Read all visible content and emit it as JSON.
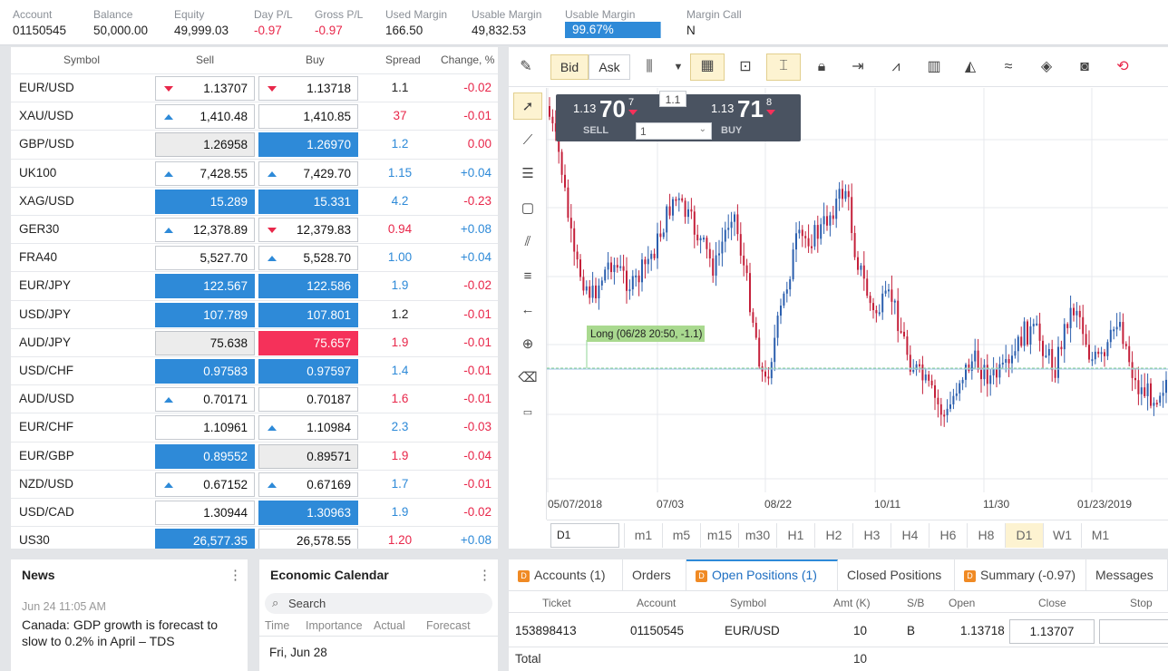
{
  "header": [
    {
      "label": "Account",
      "value": "01150545",
      "style": ""
    },
    {
      "label": "Balance",
      "value": "50,000.00",
      "style": ""
    },
    {
      "label": "Equity",
      "value": "49,999.03",
      "style": ""
    },
    {
      "label": "Day P/L",
      "value": "-0.97",
      "style": "neg"
    },
    {
      "label": "Gross P/L",
      "value": "-0.97",
      "style": "neg"
    },
    {
      "label": "Used Margin",
      "value": "166.50",
      "style": ""
    },
    {
      "label": "Usable Margin",
      "value": "49,832.53",
      "style": ""
    },
    {
      "label": "Usable Margin",
      "value": "99.67%",
      "style": "bar",
      "fill": 0.9967
    },
    {
      "label": "Margin Call",
      "value": "N",
      "style": ""
    }
  ],
  "watchlist": {
    "columns": [
      "Symbol",
      "Sell",
      "Buy",
      "Spread",
      "Change, %"
    ],
    "rows": [
      {
        "symbol": "EUR/USD",
        "sell": "1.13707",
        "sell_style": "white",
        "sell_arrow": "down",
        "buy": "1.13718",
        "buy_style": "white",
        "buy_arrow": "down",
        "spread": "1.1",
        "spread_color": "dark",
        "change": "-0.02",
        "change_color": "red"
      },
      {
        "symbol": "XAU/USD",
        "sell": "1,410.48",
        "sell_style": "white",
        "sell_arrow": "up",
        "buy": "1,410.85",
        "buy_style": "white",
        "buy_arrow": "",
        "spread": "37",
        "spread_color": "red",
        "change": "-0.01",
        "change_color": "red"
      },
      {
        "symbol": "GBP/USD",
        "sell": "1.26958",
        "sell_style": "gray",
        "sell_arrow": "",
        "buy": "1.26970",
        "buy_style": "blue",
        "buy_arrow": "",
        "spread": "1.2",
        "spread_color": "blue",
        "change": "0.00",
        "change_color": "red"
      },
      {
        "symbol": "UK100",
        "sell": "7,428.55",
        "sell_style": "white",
        "sell_arrow": "up",
        "buy": "7,429.70",
        "buy_style": "white",
        "buy_arrow": "up",
        "spread": "1.15",
        "spread_color": "blue",
        "change": "+0.04",
        "change_color": "blue"
      },
      {
        "symbol": "XAG/USD",
        "sell": "15.289",
        "sell_style": "blue",
        "sell_arrow": "",
        "buy": "15.331",
        "buy_style": "blue",
        "buy_arrow": "",
        "spread": "4.2",
        "spread_color": "blue",
        "change": "-0.23",
        "change_color": "red"
      },
      {
        "symbol": "GER30",
        "sell": "12,378.89",
        "sell_style": "white",
        "sell_arrow": "up",
        "buy": "12,379.83",
        "buy_style": "white",
        "buy_arrow": "down",
        "spread": "0.94",
        "spread_color": "red",
        "change": "+0.08",
        "change_color": "blue"
      },
      {
        "symbol": "FRA40",
        "sell": "5,527.70",
        "sell_style": "white",
        "sell_arrow": "",
        "buy": "5,528.70",
        "buy_style": "white",
        "buy_arrow": "up",
        "spread": "1.00",
        "spread_color": "blue",
        "change": "+0.04",
        "change_color": "blue"
      },
      {
        "symbol": "EUR/JPY",
        "sell": "122.567",
        "sell_style": "blue",
        "sell_arrow": "",
        "buy": "122.586",
        "buy_style": "blue",
        "buy_arrow": "",
        "spread": "1.9",
        "spread_color": "blue",
        "change": "-0.02",
        "change_color": "red"
      },
      {
        "symbol": "USD/JPY",
        "sell": "107.789",
        "sell_style": "blue",
        "sell_arrow": "",
        "buy": "107.801",
        "buy_style": "blue",
        "buy_arrow": "",
        "spread": "1.2",
        "spread_color": "dark",
        "change": "-0.01",
        "change_color": "red"
      },
      {
        "symbol": "AUD/JPY",
        "sell": "75.638",
        "sell_style": "gray",
        "sell_arrow": "",
        "buy": "75.657",
        "buy_style": "red",
        "buy_arrow": "",
        "spread": "1.9",
        "spread_color": "red",
        "change": "-0.01",
        "change_color": "red"
      },
      {
        "symbol": "USD/CHF",
        "sell": "0.97583",
        "sell_style": "blue",
        "sell_arrow": "",
        "buy": "0.97597",
        "buy_style": "blue",
        "buy_arrow": "",
        "spread": "1.4",
        "spread_color": "blue",
        "change": "-0.01",
        "change_color": "red"
      },
      {
        "symbol": "AUD/USD",
        "sell": "0.70171",
        "sell_style": "white",
        "sell_arrow": "up",
        "buy": "0.70187",
        "buy_style": "white",
        "buy_arrow": "",
        "spread": "1.6",
        "spread_color": "red",
        "change": "-0.01",
        "change_color": "red"
      },
      {
        "symbol": "EUR/CHF",
        "sell": "1.10961",
        "sell_style": "white",
        "sell_arrow": "",
        "buy": "1.10984",
        "buy_style": "white",
        "buy_arrow": "up",
        "spread": "2.3",
        "spread_color": "blue",
        "change": "-0.03",
        "change_color": "red"
      },
      {
        "symbol": "EUR/GBP",
        "sell": "0.89552",
        "sell_style": "blue",
        "sell_arrow": "",
        "buy": "0.89571",
        "buy_style": "gray",
        "buy_arrow": "",
        "spread": "1.9",
        "spread_color": "red",
        "change": "-0.04",
        "change_color": "red"
      },
      {
        "symbol": "NZD/USD",
        "sell": "0.67152",
        "sell_style": "white",
        "sell_arrow": "up",
        "buy": "0.67169",
        "buy_style": "white",
        "buy_arrow": "up",
        "spread": "1.7",
        "spread_color": "blue",
        "change": "-0.01",
        "change_color": "red"
      },
      {
        "symbol": "USD/CAD",
        "sell": "1.30944",
        "sell_style": "white",
        "sell_arrow": "",
        "buy": "1.30963",
        "buy_style": "blue",
        "buy_arrow": "",
        "spread": "1.9",
        "spread_color": "blue",
        "change": "-0.02",
        "change_color": "red"
      },
      {
        "symbol": "US30",
        "sell": "26,577.35",
        "sell_style": "blue",
        "sell_arrow": "",
        "buy": "26,578.55",
        "buy_style": "white",
        "buy_arrow": "",
        "spread": "1.20",
        "spread_color": "red",
        "change": "+0.08",
        "change_color": "blue"
      }
    ]
  },
  "chart": {
    "toolbar": {
      "bid_label": "Bid",
      "ask_label": "Ask"
    },
    "ticket": {
      "sell_prefix": "1.13",
      "sell_big": "70",
      "sell_sup": "7",
      "buy_prefix": "1.13",
      "buy_big": "71",
      "buy_sup": "8",
      "spread": "1.1",
      "sell_label": "SELL",
      "buy_label": "BUY",
      "amount": "1"
    },
    "position_label": "Long (06/28 20:50, -1.1)",
    "x_ticks": [
      "05/07/2018",
      "07/03",
      "08/22",
      "10/11",
      "11/30",
      "01/23/2019"
    ],
    "timeframe_value": "D1",
    "timeframes": [
      "m1",
      "m5",
      "m15",
      "m30",
      "H1",
      "H2",
      "H3",
      "H4",
      "H6",
      "H8",
      "D1",
      "W1",
      "M1"
    ],
    "active_timeframe": "D1",
    "colors": {
      "up": "#2b5fae",
      "down": "#c4203a",
      "grid": "#e7e9ee",
      "position_line": "#8fd694"
    }
  },
  "news": {
    "title": "News",
    "time": "Jun 24 11:05 AM",
    "headline": "Canada: GDP growth is forecast to slow to 0.2% in April – TDS"
  },
  "econ": {
    "title": "Economic Calendar",
    "search_placeholder": "Search",
    "columns": [
      "Time",
      "Importance",
      "Actual",
      "Forecast"
    ],
    "date": "Fri, Jun 28"
  },
  "bottom": {
    "tabs": [
      {
        "label": "Accounts (1)",
        "icon": true
      },
      {
        "label": "Orders",
        "icon": false
      },
      {
        "label": "Open Positions (1)",
        "icon": true
      },
      {
        "label": "Closed Positions",
        "icon": false
      },
      {
        "label": "Summary (-0.97)",
        "icon": true
      },
      {
        "label": "Messages",
        "icon": false
      }
    ],
    "active_tab": 2,
    "columns": [
      "Ticket",
      "Account",
      "Symbol",
      "Amt (K)",
      "S/B",
      "Open",
      "Close",
      "Stop"
    ],
    "row": {
      "ticket": "153898413",
      "account": "01150545",
      "symbol": "EUR/USD",
      "amount": "10",
      "side": "B",
      "open": "1.13718",
      "close": "1.13707",
      "stop": ""
    },
    "total_label": "Total",
    "total_amount": "10"
  }
}
